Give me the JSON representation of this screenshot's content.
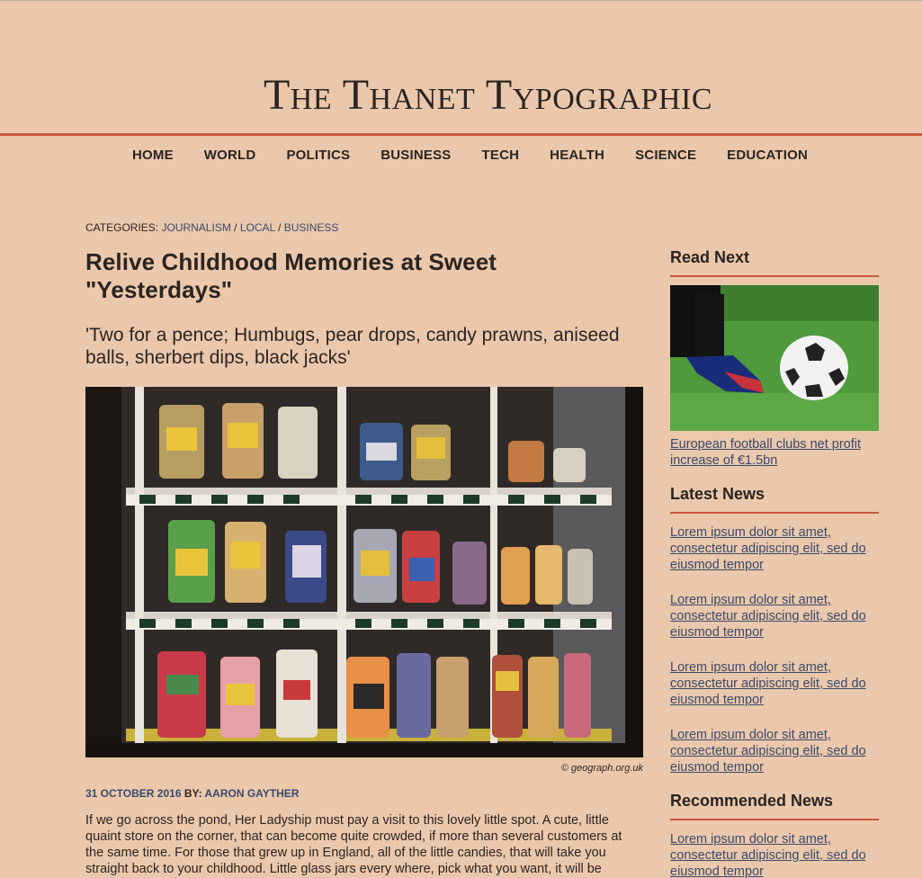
{
  "site": {
    "title": "The Thanet Typographic"
  },
  "nav": [
    "HOME",
    "WORLD",
    "POLITICS",
    "BUSINESS",
    "TECH",
    "HEALTH",
    "SCIENCE",
    "EDUCATION"
  ],
  "article": {
    "categories_label": "CATEGORIES: ",
    "categories": [
      "JOURNALISM",
      "LOCAL",
      "BUSINESS"
    ],
    "title": "Relive Childhood Memories at Sweet \"Yesterdays\"",
    "subtitle": "'Two for a pence; Humbugs, pear drops, candy prawns, aniseed balls, sherbert dips, black jacks'",
    "image_credit": "© geograph.org.uk",
    "date": "31 OCTOBER 2016",
    "by_label": " BY: ",
    "author": "AARON GAYTHER",
    "body": "If we go across the pond, Her Ladyship must pay a visit to this lovely little spot. A cute, little quaint store on the corner, that can become quite crowded, if more than several customers at the same time. For those that grew up in England, all of the little candies, that will take you straight back to your childhood. Little glass jars every where, pick what you want, it will be weighed, and then placed in a little white paper bag."
  },
  "sidebar": {
    "read_next": {
      "heading": "Read Next",
      "caption": "European football clubs net profit increase of €1.5bn"
    },
    "latest": {
      "heading": "Latest News",
      "items": [
        "Lorem ipsum dolor sit amet, consectetur adipiscing elit, sed do eiusmod tempor",
        "Lorem ipsum dolor sit amet, consectetur adipiscing elit, sed do eiusmod tempor",
        "Lorem ipsum dolor sit amet, consectetur adipiscing elit, sed do eiusmod tempor",
        "Lorem ipsum dolor sit amet, consectetur adipiscing elit, sed do eiusmod tempor"
      ]
    },
    "recommended": {
      "heading": "Recommended News",
      "items": [
        "Lorem ipsum dolor sit amet, consectetur adipiscing elit, sed do eiusmod tempor"
      ]
    }
  },
  "colors": {
    "background": "#ebc8ac",
    "accent_rule": "#c8573b",
    "link": "#3a4a6b",
    "text": "#2b2421"
  }
}
